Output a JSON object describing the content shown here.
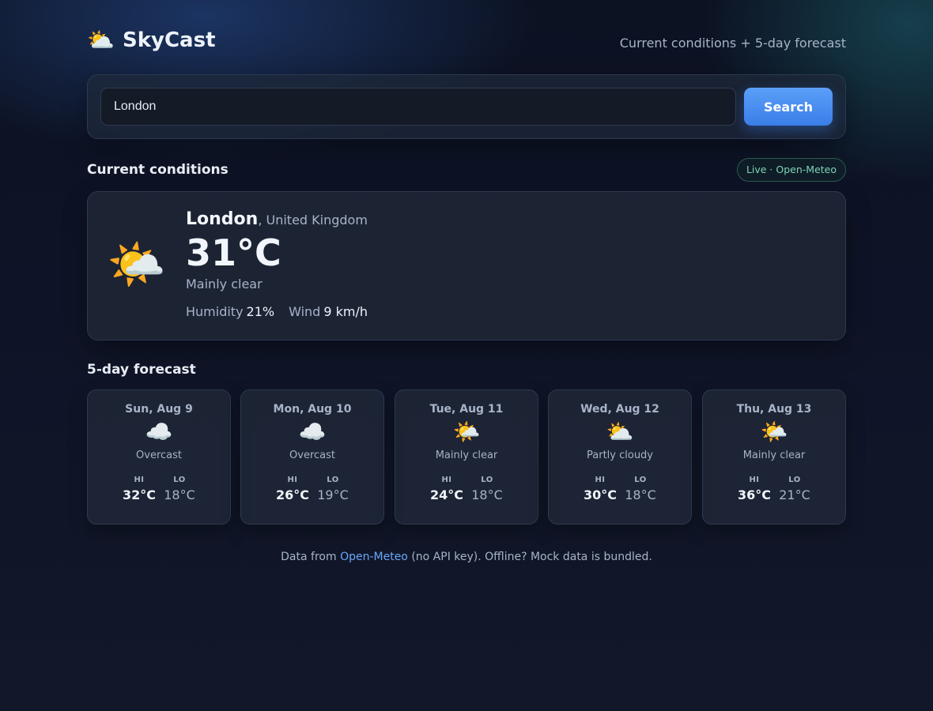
{
  "header": {
    "logo_icon": "sun-behind-cloud-icon",
    "brand_name": "SkyCast",
    "tagline": "Current conditions + 5-day forecast"
  },
  "search": {
    "value": "London",
    "button_label": "Search"
  },
  "current": {
    "section_title": "Current conditions",
    "badge": "Live · Open-Meteo",
    "icon": "sun-behind-large-cloud-icon",
    "city": "London",
    "country": ", United Kingdom",
    "temperature": "31°C",
    "condition": "Mainly clear",
    "humidity_label": "Humidity",
    "humidity_value": "21%",
    "wind_label": "Wind",
    "wind_value": "9 km/h"
  },
  "forecast": {
    "section_title": "5-day forecast",
    "hi_label": "HI",
    "lo_label": "LO",
    "days": [
      {
        "date": "Sun, Aug 9",
        "icon": "cloud-icon",
        "condition": "Overcast",
        "hi": "32°C",
        "lo": "18°C"
      },
      {
        "date": "Mon, Aug 10",
        "icon": "cloud-icon",
        "condition": "Overcast",
        "hi": "26°C",
        "lo": "19°C"
      },
      {
        "date": "Tue, Aug 11",
        "icon": "sun-behind-large-cloud-icon",
        "condition": "Mainly clear",
        "hi": "24°C",
        "lo": "18°C"
      },
      {
        "date": "Wed, Aug 12",
        "icon": "sun-behind-cloud-icon",
        "condition": "Partly cloudy",
        "hi": "30°C",
        "lo": "18°C"
      },
      {
        "date": "Thu, Aug 13",
        "icon": "sun-behind-large-cloud-icon",
        "condition": "Mainly clear",
        "hi": "36°C",
        "lo": "21°C"
      }
    ]
  },
  "footer": {
    "prefix": "Data from ",
    "link_text": "Open-Meteo",
    "suffix": " (no API key). Offline? Mock data is bundled."
  }
}
